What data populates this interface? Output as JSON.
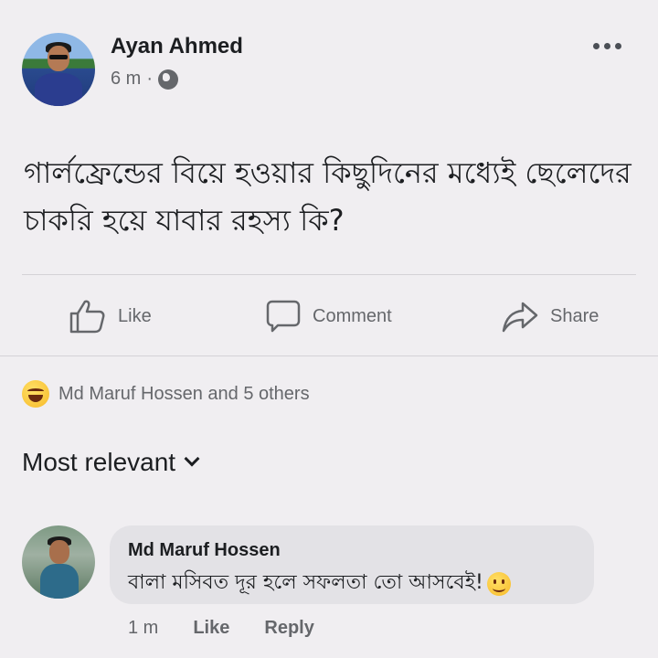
{
  "post": {
    "author": "Ayan Ahmed",
    "time": "6 m",
    "separator": "·",
    "privacy_icon": "globe-icon",
    "more_icon": "more-horizontal-icon",
    "text": "গার্লফ্রেন্ডের বিয়ে হওয়ার কিছুদিনের মধ্যেই ছেলেদের চাকরি হয়ে যাবার রহস্য কি?"
  },
  "actions": {
    "like": "Like",
    "comment": "Comment",
    "share": "Share"
  },
  "reactions": {
    "icon": "haha-emoji-icon",
    "summary": "Md Maruf Hossen and 5 others"
  },
  "sort": {
    "label": "Most relevant"
  },
  "comments": [
    {
      "name": "Md Maruf Hossen",
      "text": "বালা মসিবত দূর হলে সফলতা তো আসবেই!",
      "emoji": "smile-emoji-icon",
      "time": "1 m",
      "like": "Like",
      "reply": "Reply"
    }
  ],
  "colors": {
    "background": "#f0eef1",
    "text": "#1c1e21",
    "secondary": "#65676b",
    "bubble": "#e3e2e6"
  }
}
